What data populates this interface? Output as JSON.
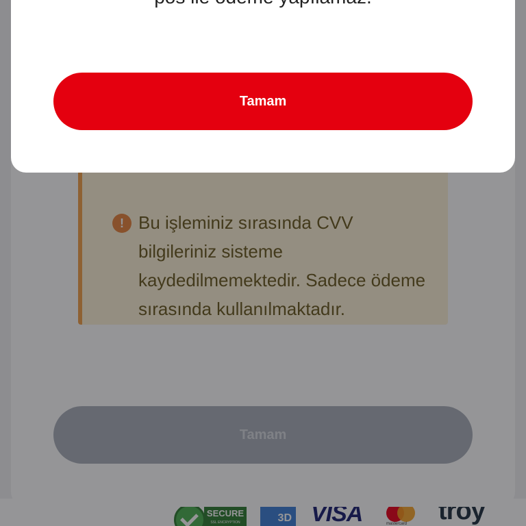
{
  "modal": {
    "message": "pos ile ödeme yapılamaz.",
    "ok_label": "Tamam"
  },
  "warning": {
    "icon": "exclamation-icon",
    "text": "Bu işleminiz sırasında CVV bilgileriniz sisteme kaydedilmemektedir. Sadece ödeme sırasında kullanılmaktadır."
  },
  "form": {
    "submit_label": "Tamam"
  },
  "footer_logos": {
    "secure_label": "SECURE",
    "secure_sub": "SSL ENCRYPTION",
    "three_d_label": "3D",
    "visa_label": "VISA",
    "mastercard_label": "mastercard",
    "troy_label": "troy"
  },
  "colors": {
    "primary_button": "#e4000f",
    "disabled_button": "#a9b0ba",
    "warning_bg": "#fdf3d8",
    "warning_border": "#f2a14a",
    "warning_text": "#6b5a20"
  }
}
